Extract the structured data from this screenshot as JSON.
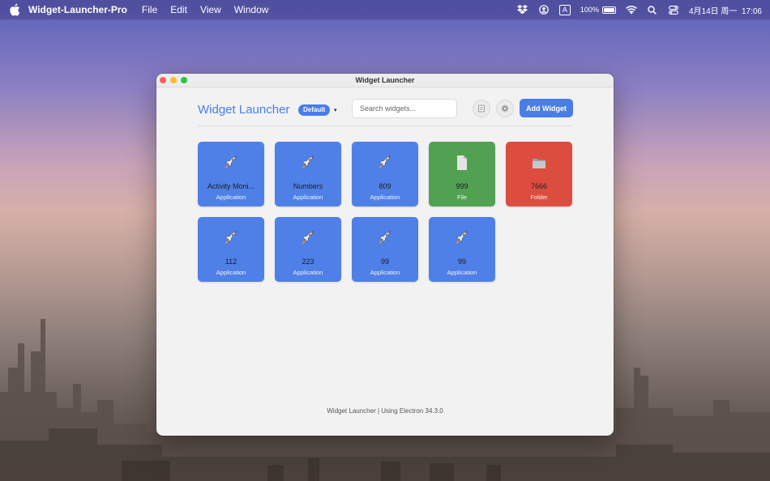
{
  "menubar": {
    "app_name": "Widget-Launcher-Pro",
    "menus": [
      "File",
      "Edit",
      "View",
      "Window"
    ],
    "status": {
      "input_method": "A",
      "battery": "100%",
      "datetime": "4月14日 周一  17:06"
    }
  },
  "window": {
    "title": "Widget Launcher"
  },
  "header": {
    "app_title": "Widget Launcher",
    "profile_label": "Default",
    "profile_arrow": "▾",
    "search_placeholder": "Search widgets...",
    "add_widget_label": "Add Widget"
  },
  "widgets": [
    {
      "name": "Activity Moni...",
      "type": "Application",
      "color": "#4f80e8",
      "icon": "rocket-icon"
    },
    {
      "name": "Numbers",
      "type": "Application",
      "color": "#4f80e8",
      "icon": "rocket-icon"
    },
    {
      "name": "809",
      "type": "Application",
      "color": "#4f80e8",
      "icon": "rocket-icon"
    },
    {
      "name": "999",
      "type": "File",
      "color": "#52a153",
      "icon": "file-icon"
    },
    {
      "name": "7666",
      "type": "Folder",
      "color": "#dd4d3f",
      "icon": "folder-icon"
    },
    {
      "name": "112",
      "type": "Application",
      "color": "#4f80e8",
      "icon": "rocket-icon"
    },
    {
      "name": "223",
      "type": "Application",
      "color": "#4f80e8",
      "icon": "rocket-icon"
    },
    {
      "name": "99",
      "type": "Application",
      "color": "#4f80e8",
      "icon": "rocket-icon"
    },
    {
      "name": "99",
      "type": "Application",
      "color": "#4f80e8",
      "icon": "rocket-icon"
    }
  ],
  "footer": "Widget Launcher | Using Electron 34.3.0"
}
